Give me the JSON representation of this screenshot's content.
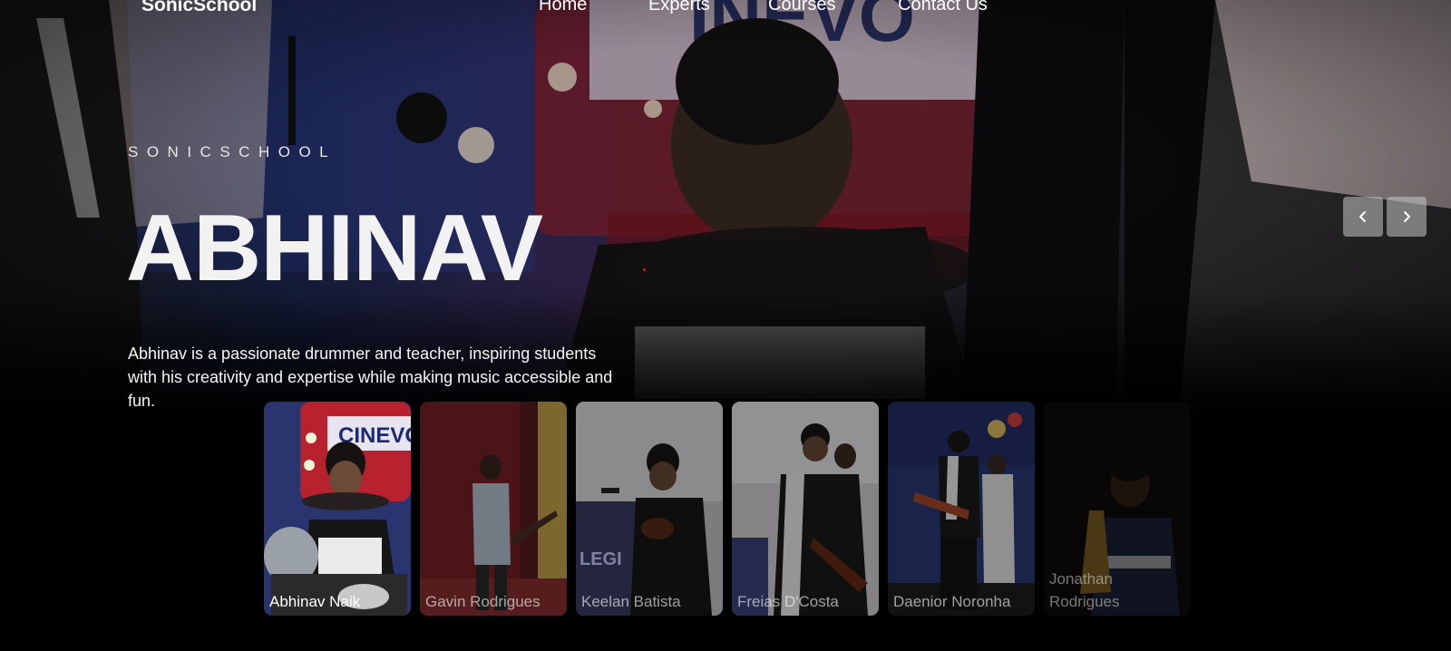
{
  "brand": {
    "logo": "SonicSchool"
  },
  "nav": {
    "items": [
      "Home",
      "Experts",
      "Courses",
      "Contact Us"
    ]
  },
  "hero": {
    "eyebrow": "SONICSCHOOL",
    "title": "ABHINAV",
    "description": "Abhinav is a passionate drummer and teacher, inspiring students with his creativity and expertise while making music accessible and fun."
  },
  "carousel": {
    "prev_icon": "chevron-left-icon",
    "next_icon": "chevron-right-icon",
    "cards": [
      {
        "name": "Abhinav Naik",
        "active": true
      },
      {
        "name": "Gavin Rodrigues",
        "active": false
      },
      {
        "name": "Keelan Batista",
        "active": false
      },
      {
        "name": "Freias D'Costa",
        "active": false
      },
      {
        "name": "Daenior Noronha",
        "active": false
      },
      {
        "name": "Jonathan Rodrigues",
        "active": false
      }
    ]
  },
  "colors": {
    "background": "#000000",
    "text": "#ffffff",
    "arrow_bg": "#c8c8c8"
  }
}
